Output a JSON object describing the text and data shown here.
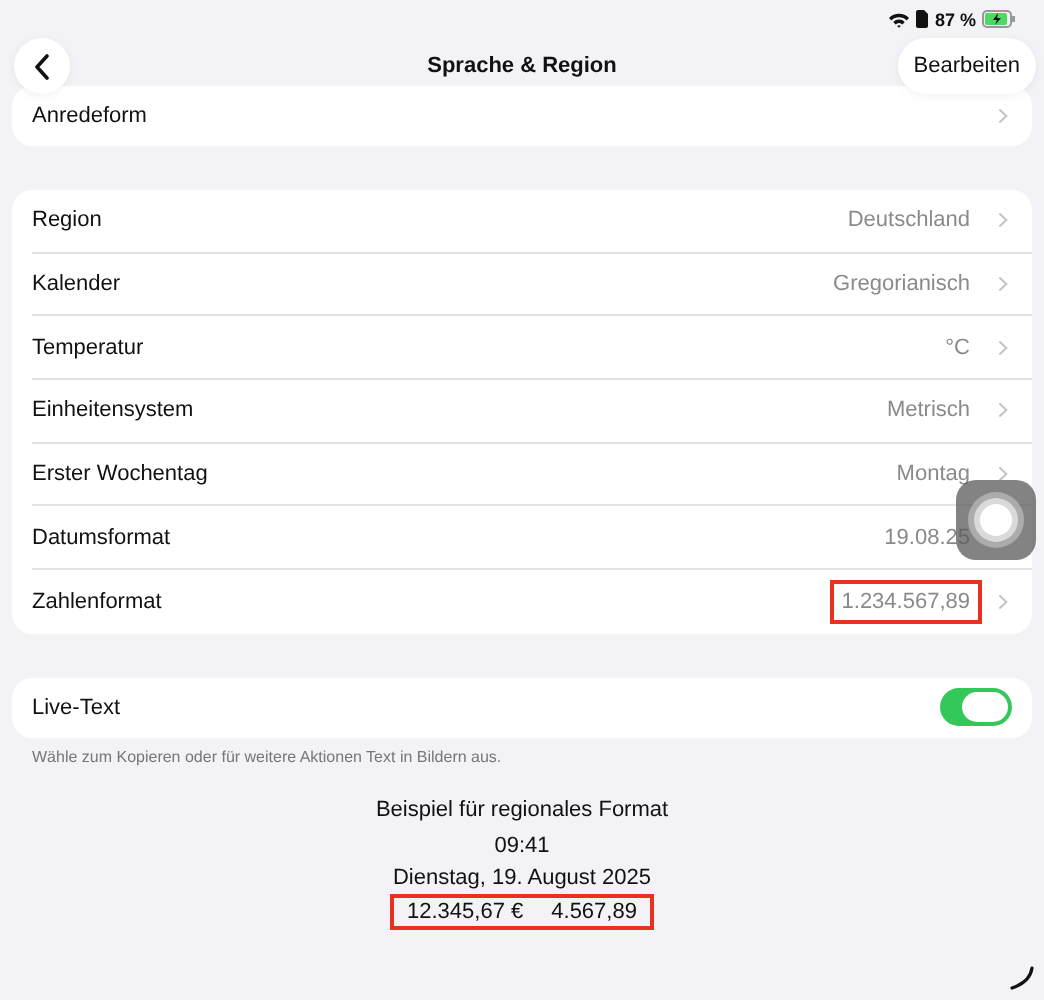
{
  "status_bar": {
    "battery": "87 %",
    "charging": true
  },
  "nav": {
    "title": "Sprache & Region",
    "edit_button": "Bearbeiten"
  },
  "top_card": {
    "label": "Anredeform"
  },
  "rows": [
    {
      "label": "Region",
      "value": "Deutschland",
      "highlighted": false
    },
    {
      "label": "Kalender",
      "value": "Gregorianisch",
      "highlighted": false
    },
    {
      "label": "Temperatur",
      "value": "°C",
      "highlighted": false
    },
    {
      "label": "Einheitensystem",
      "value": "Metrisch",
      "highlighted": false
    },
    {
      "label": "Erster Wochentag",
      "value": "Montag",
      "highlighted": false
    },
    {
      "label": "Datumsformat",
      "value": "19.08.25",
      "highlighted": false
    },
    {
      "label": "Zahlenformat",
      "value": "1.234.567,89",
      "highlighted": true
    }
  ],
  "live_text": {
    "label": "Live-Text",
    "on": true,
    "footer": "Wähle zum Kopieren oder für weitere Aktionen Text in Bildern aus."
  },
  "example": {
    "title": "Beispiel für regionales Format",
    "time": "09:41",
    "date": "Dienstag, 19. August 2025",
    "currency": "12.345,67 €",
    "number": "4.567,89",
    "highlighted": true
  }
}
